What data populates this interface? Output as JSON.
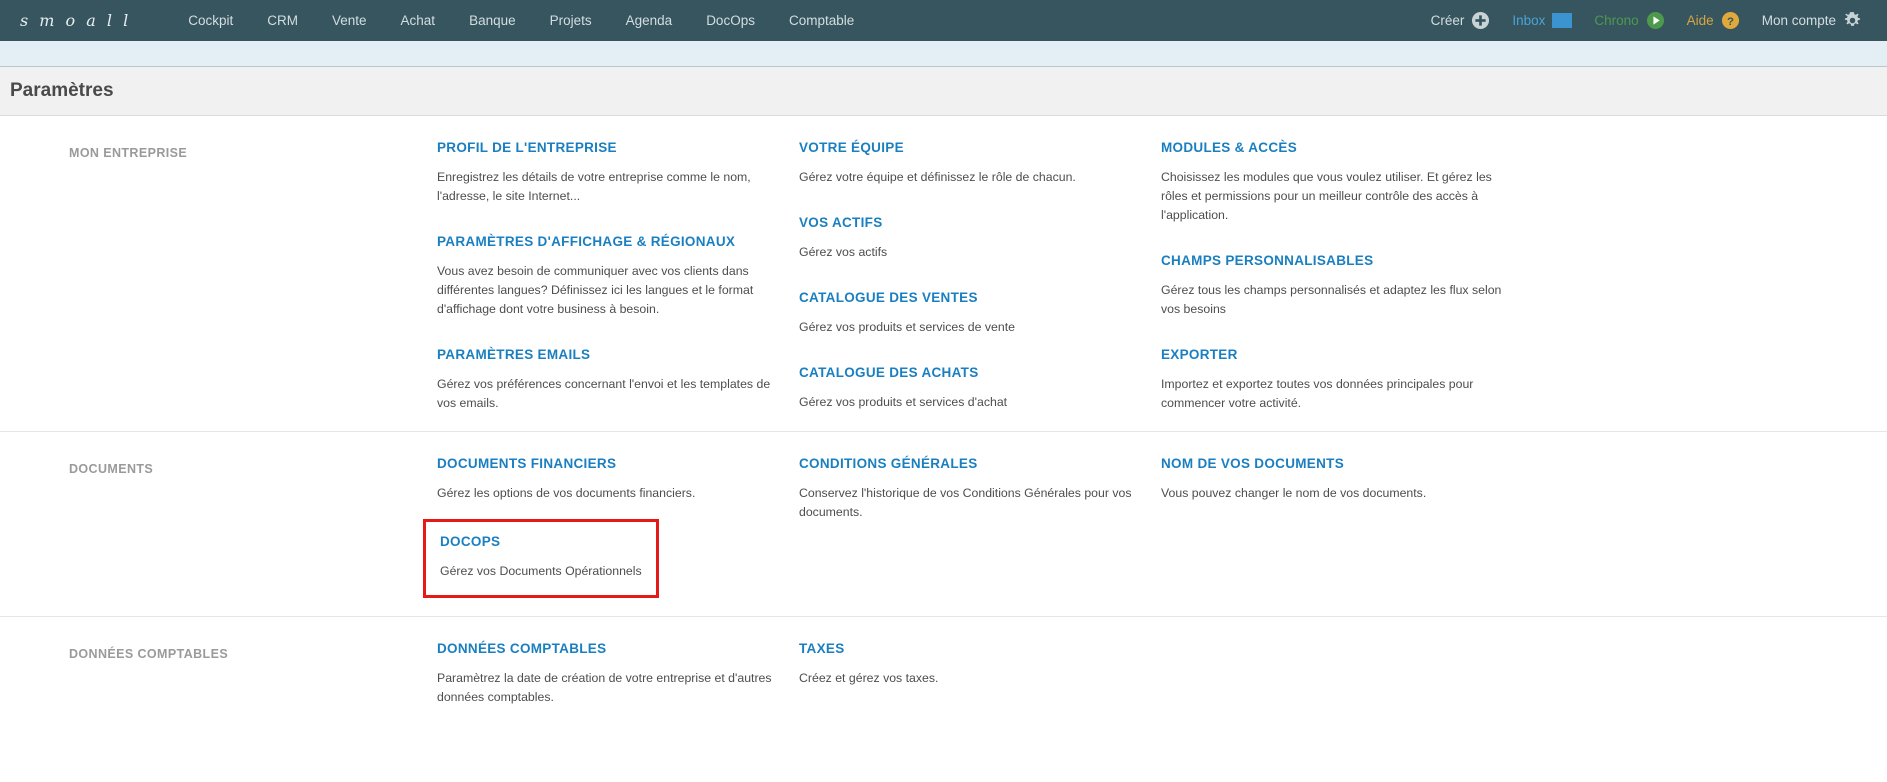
{
  "brand": {
    "logo_text": "s m o a l l"
  },
  "nav": {
    "items": [
      {
        "label": "Cockpit"
      },
      {
        "label": "CRM"
      },
      {
        "label": "Vente"
      },
      {
        "label": "Achat"
      },
      {
        "label": "Banque"
      },
      {
        "label": "Projets"
      },
      {
        "label": "Agenda"
      },
      {
        "label": "DocOps"
      },
      {
        "label": "Comptable"
      }
    ],
    "actions": [
      {
        "label": "Créer",
        "icon": "plus-circle-icon",
        "color": "#d4dde0"
      },
      {
        "label": "Inbox",
        "icon": "envelope-icon",
        "color": "#4aa3d8"
      },
      {
        "label": "Chrono",
        "icon": "play-circle-icon",
        "color": "#4d9a4d"
      },
      {
        "label": "Aide",
        "icon": "question-circle-icon",
        "color": "#d9a441"
      },
      {
        "label": "Mon compte",
        "icon": "gear-icon",
        "color": "#d4dde0"
      }
    ]
  },
  "page": {
    "title": "Paramètres"
  },
  "colors": {
    "header_bg": "#36555f",
    "link_blue": "#1a7fc1",
    "highlight_red": "#e61919",
    "section_label_grey": "#9a9a9a"
  },
  "sections": [
    {
      "label": "MON ENTREPRISE",
      "columns": [
        [
          {
            "title": "PROFIL DE L'ENTREPRISE",
            "desc": "Enregistrez les détails de votre entreprise comme le nom, l'adresse, le site Internet..."
          },
          {
            "title": "PARAMÈTRES D'AFFICHAGE & RÉGIONAUX",
            "desc": "Vous avez besoin de communiquer avec vos clients dans différentes langues? Définissez ici les langues et le format d'affichage dont votre business à besoin."
          },
          {
            "title": "PARAMÈTRES EMAILS",
            "desc": "Gérez vos préférences concernant l'envoi et les templates de vos emails."
          }
        ],
        [
          {
            "title": "VOTRE ÉQUIPE",
            "desc": "Gérez votre équipe et définissez le rôle de chacun."
          },
          {
            "title": "VOS ACTIFS",
            "desc": "Gérez vos actifs"
          },
          {
            "title": "CATALOGUE DES VENTES",
            "desc": "Gérez vos produits et services de vente"
          },
          {
            "title": "CATALOGUE DES ACHATS",
            "desc": "Gérez vos produits et services d'achat"
          }
        ],
        [
          {
            "title": "MODULES & ACCÈS",
            "desc": "Choisissez les modules que vous voulez utiliser. Et gérez les rôles et permissions pour un meilleur contrôle des accès à l'application."
          },
          {
            "title": "CHAMPS PERSONNALISABLES",
            "desc": "Gérez tous les champs personnalisés et adaptez les flux selon vos besoins"
          },
          {
            "title": "EXPORTER",
            "desc": "Importez et exportez toutes vos données principales pour commencer votre activité."
          }
        ]
      ]
    },
    {
      "label": "DOCUMENTS",
      "columns": [
        [
          {
            "title": "DOCUMENTS FINANCIERS",
            "desc": "Gérez les options de vos documents financiers."
          },
          {
            "title": "DOCOPS",
            "desc": "Gérez vos Documents Opérationnels",
            "highlighted": true
          }
        ],
        [
          {
            "title": "CONDITIONS GÉNÉRALES",
            "desc": "Conservez l'historique de vos Conditions Générales pour vos documents."
          }
        ],
        [
          {
            "title": "NOM DE VOS DOCUMENTS",
            "desc": "Vous pouvez changer le nom de vos documents."
          }
        ]
      ]
    },
    {
      "label": "DONNÉES COMPTABLES",
      "columns": [
        [
          {
            "title": "DONNÉES COMPTABLES",
            "desc": "Paramètrez la date de création de votre entreprise et d'autres données comptables."
          }
        ],
        [
          {
            "title": "TAXES",
            "desc": "Créez et gérez vos taxes."
          }
        ],
        []
      ]
    }
  ]
}
